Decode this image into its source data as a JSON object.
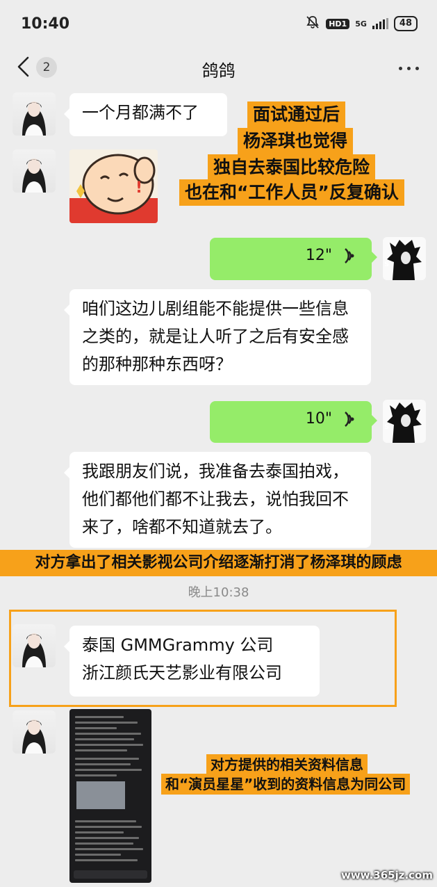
{
  "status_bar": {
    "time": "10:40",
    "hd": "HD1",
    "network": "5G",
    "battery": "48"
  },
  "nav": {
    "back_count": "2",
    "title": "鸽鸽"
  },
  "messages": {
    "m1": "一个月都满不了",
    "v1_duration": "12\"",
    "m2": "咱们这边儿剧组能不能提供一些信息之类的，就是让人听了之后有安全感的那种那种东西呀？",
    "v2_duration": "10\"",
    "m3": "我跟朋友们说，我准备去泰国拍戏，他们都他们都不让我去，说怕我回不来了，啥都不知道就去了。",
    "time": "晚上10:38",
    "m4_line1": "泰国 GMMGrammy 公司",
    "m4_line2": "浙江颜氏天艺影业有限公司"
  },
  "annotations": {
    "a1": [
      "面试通过后",
      "杨泽琪也觉得",
      "独自去泰国比较危险",
      "也在和“工作人员”反复确认"
    ],
    "a2": "对方拿出了相关影视公司介绍逐渐打消了杨泽琪的顾虑",
    "a3": [
      "对方提供的相关资料信息",
      "和“演员星星”收到的资料信息为同公司"
    ]
  },
  "watermark": "www.365jz.com",
  "colors": {
    "voice_bubble": "#95ec69",
    "annotation": "#f7a11a",
    "background": "#ededed"
  }
}
